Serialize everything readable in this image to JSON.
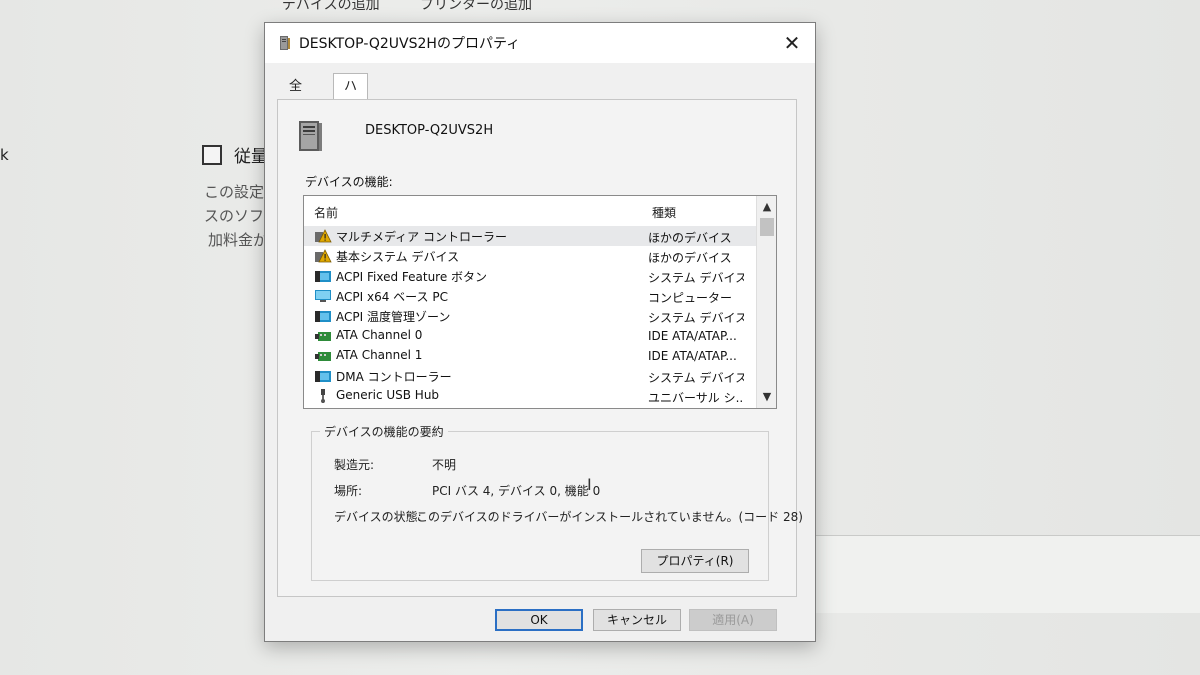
{
  "background": {
    "top_items": [
      "デバイスの追加",
      "プリンターの追加"
    ],
    "left_edge_text": "k",
    "checkbox_label": "従量制",
    "description_lines": [
      "この設定を",
      "スのソフトウ",
      "加料金が"
    ]
  },
  "dialog": {
    "title": "DESKTOP-Q2UVS2Hのプロパティ",
    "close_glyph": "✕",
    "tabs": [
      {
        "label": "全般"
      },
      {
        "label": "ハードウェア"
      }
    ],
    "device_name": "DESKTOP-Q2UVS2H",
    "functions_label": "デバイスの機能:",
    "list": {
      "columns": {
        "name": "名前",
        "type": "種類"
      },
      "rows": [
        {
          "name": "マルチメディア コントローラー",
          "type": "ほかのデバイス",
          "icon": "warning-device-icon"
        },
        {
          "name": "基本システム デバイス",
          "type": "ほかのデバイス",
          "icon": "warning-device-icon"
        },
        {
          "name": "ACPI Fixed Feature ボタン",
          "type": "システム デバイス",
          "icon": "system-device-icon"
        },
        {
          "name": "ACPI x64 ベース PC",
          "type": "コンピューター",
          "icon": "computer-icon"
        },
        {
          "name": "ACPI 温度管理ゾーン",
          "type": "システム デバイス",
          "icon": "system-device-icon"
        },
        {
          "name": "ATA Channel 0",
          "type": "IDE ATA/ATAP...",
          "icon": "ide-controller-icon"
        },
        {
          "name": "ATA Channel 1",
          "type": "IDE ATA/ATAP...",
          "icon": "ide-controller-icon"
        },
        {
          "name": "DMA コントローラー",
          "type": "システム デバイス",
          "icon": "system-device-icon"
        },
        {
          "name": "Generic USB Hub",
          "type": "ユニバーサル シ...",
          "icon": "usb-icon"
        }
      ]
    },
    "summary": {
      "legend": "デバイスの機能の要約",
      "manufacturer_label": "製造元:",
      "manufacturer_value": "不明",
      "location_label": "場所:",
      "location_value": "PCI バス 4, デバイス 0, 機能 0",
      "status_label": "デバイスの状態:",
      "status_value": "このデバイスのドライバーがインストールされていません。(コード 28)",
      "properties_button": "プロパティ(R)"
    },
    "buttons": {
      "ok": "OK",
      "cancel": "キャンセル",
      "apply": "適用(A)"
    }
  },
  "colors": {
    "ok_border": "#2b6fc4",
    "selected_row": "#e7e8ea",
    "warning": "#e0a800"
  }
}
